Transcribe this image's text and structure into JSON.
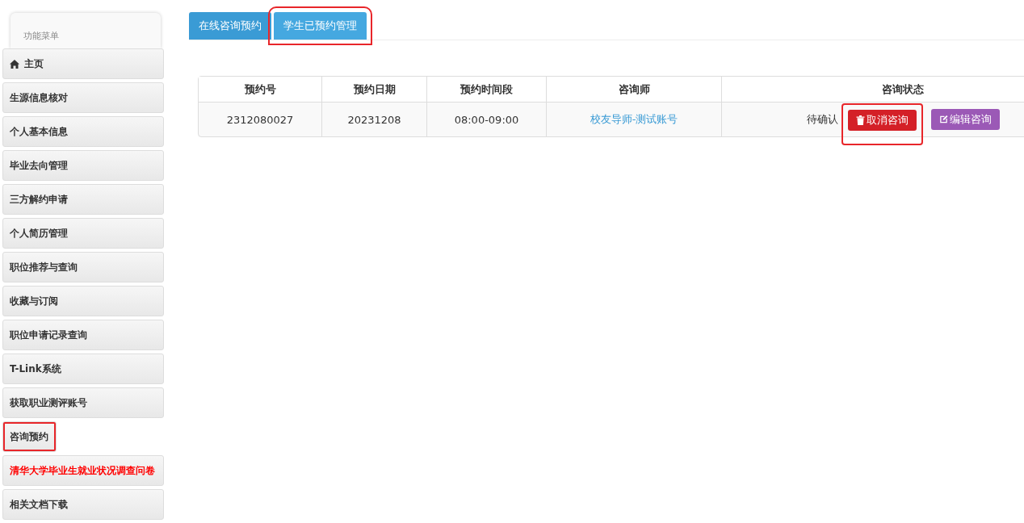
{
  "sidebar": {
    "title": "功能菜单",
    "items": [
      {
        "label": "主页",
        "kind": "home",
        "emphasis": false,
        "annotated": false
      },
      {
        "label": "生源信息核对",
        "emphasis": false,
        "annotated": false
      },
      {
        "label": "个人基本信息",
        "emphasis": false,
        "annotated": false
      },
      {
        "label": "毕业去向管理",
        "emphasis": false,
        "annotated": false
      },
      {
        "label": "三方解约申请",
        "emphasis": false,
        "annotated": false
      },
      {
        "label": "个人简历管理",
        "emphasis": false,
        "annotated": false
      },
      {
        "label": "职位推荐与查询",
        "emphasis": false,
        "annotated": false
      },
      {
        "label": "收藏与订阅",
        "emphasis": false,
        "annotated": false
      },
      {
        "label": "职位申请记录查询",
        "emphasis": false,
        "annotated": false
      },
      {
        "label": "T-Link系统",
        "emphasis": false,
        "annotated": false
      },
      {
        "label": "获取职业测评账号",
        "emphasis": false,
        "annotated": false
      },
      {
        "label": "咨询预约",
        "emphasis": false,
        "annotated": true
      },
      {
        "label": "清华大学毕业生就业状况调查问卷",
        "emphasis": true,
        "annotated": false
      },
      {
        "label": "相关文档下载",
        "emphasis": false,
        "annotated": false
      }
    ]
  },
  "tabs": [
    {
      "label": "在线咨询预约",
      "selected": false,
      "annotated": false
    },
    {
      "label": "学生已预约管理",
      "selected": true,
      "annotated": true
    }
  ],
  "table": {
    "columns": [
      "预约号",
      "预约日期",
      "预约时间段",
      "咨询师",
      "咨询状态"
    ],
    "rows": [
      {
        "number": "2312080027",
        "date": "20231208",
        "time": "08:00-09:00",
        "counselor": "校友导师-测试账号",
        "status": "待确认",
        "actions": [
          {
            "label": "取消咨询",
            "kind": "delete",
            "annotated": true
          },
          {
            "label": "编辑咨询",
            "kind": "edit",
            "annotated": false
          }
        ]
      }
    ]
  }
}
